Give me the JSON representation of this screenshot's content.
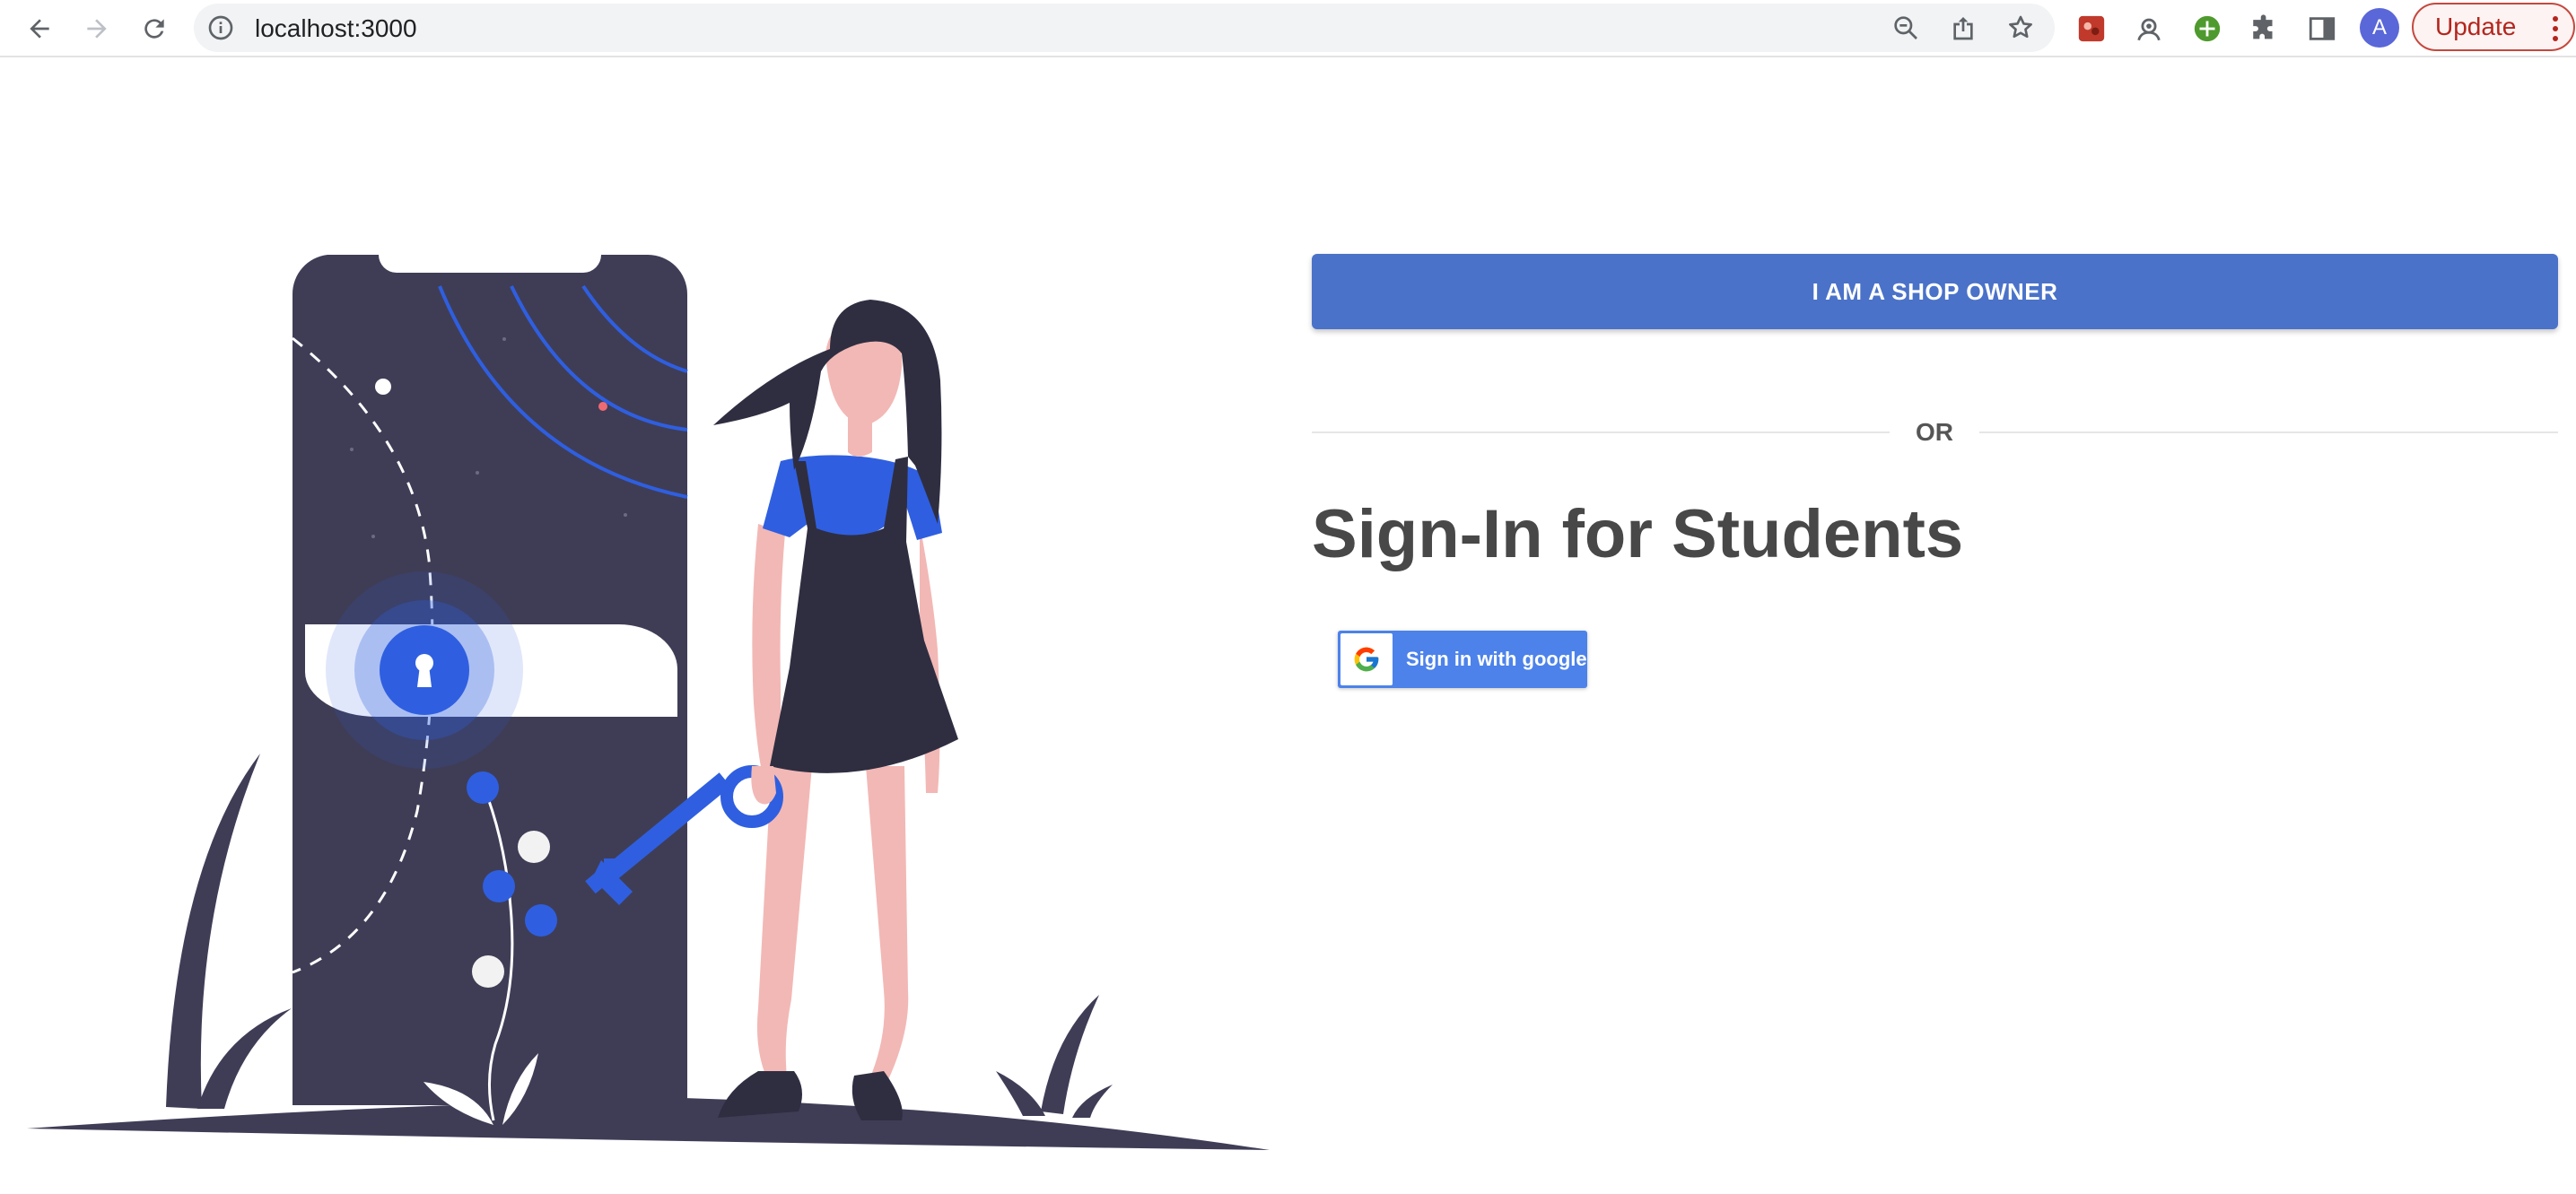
{
  "browser": {
    "url": "localhost:3000",
    "profile_initial": "A",
    "update_label": "Update"
  },
  "main": {
    "shop_owner_button": "I AM A SHOP OWNER",
    "divider_text": "OR",
    "title": "Sign-In for Students",
    "google_button": "Sign in with google"
  },
  "colors": {
    "primary": "#4a72c8",
    "google_blue": "#4c82ea",
    "illustration_dark": "#3f3d56",
    "illustration_blue": "#2f5fe0"
  }
}
